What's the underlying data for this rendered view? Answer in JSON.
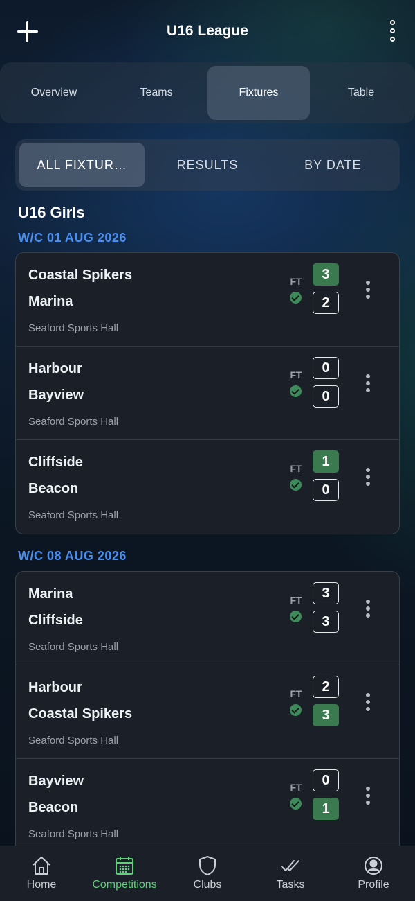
{
  "header": {
    "title": "U16 League"
  },
  "top_tabs": [
    {
      "label": "Overview",
      "active": false
    },
    {
      "label": "Teams",
      "active": false
    },
    {
      "label": "Fixtures",
      "active": true
    },
    {
      "label": "Table",
      "active": false
    }
  ],
  "filter_tabs": [
    {
      "label": "ALL FIXTUR…",
      "active": true
    },
    {
      "label": "RESULTS",
      "active": false
    },
    {
      "label": "BY DATE",
      "active": false
    }
  ],
  "section_title": "U16 Girls",
  "weeks": [
    {
      "label": "W/C 01 AUG 2026",
      "fixtures": [
        {
          "home": "Coastal Spikers",
          "away": "Marina",
          "venue": "Seaford Sports Hall",
          "status": "FT",
          "home_score": "3",
          "away_score": "2",
          "winner": "home"
        },
        {
          "home": "Harbour",
          "away": "Bayview",
          "venue": "Seaford Sports Hall",
          "status": "FT",
          "home_score": "0",
          "away_score": "0",
          "winner": "none"
        },
        {
          "home": "Cliffside",
          "away": "Beacon",
          "venue": "Seaford Sports Hall",
          "status": "FT",
          "home_score": "1",
          "away_score": "0",
          "winner": "home"
        }
      ]
    },
    {
      "label": "W/C 08 AUG 2026",
      "fixtures": [
        {
          "home": "Marina",
          "away": "Cliffside",
          "venue": "Seaford Sports Hall",
          "status": "FT",
          "home_score": "3",
          "away_score": "3",
          "winner": "none"
        },
        {
          "home": "Harbour",
          "away": "Coastal Spikers",
          "venue": "Seaford Sports Hall",
          "status": "FT",
          "home_score": "2",
          "away_score": "3",
          "winner": "away"
        },
        {
          "home": "Bayview",
          "away": "Beacon",
          "venue": "Seaford Sports Hall",
          "status": "FT",
          "home_score": "0",
          "away_score": "1",
          "winner": "away"
        }
      ]
    }
  ],
  "bottom_nav": [
    {
      "label": "Home",
      "icon": "home-icon",
      "active": false
    },
    {
      "label": "Competitions",
      "icon": "calendar-icon",
      "active": true
    },
    {
      "label": "Clubs",
      "icon": "shield-icon",
      "active": false
    },
    {
      "label": "Tasks",
      "icon": "double-check-icon",
      "active": false
    },
    {
      "label": "Profile",
      "icon": "profile-icon",
      "active": false
    }
  ],
  "colors": {
    "accent_green": "#5fd07a",
    "win_score_bg": "#3a7a4e",
    "week_label_blue": "#4a8ef0"
  }
}
